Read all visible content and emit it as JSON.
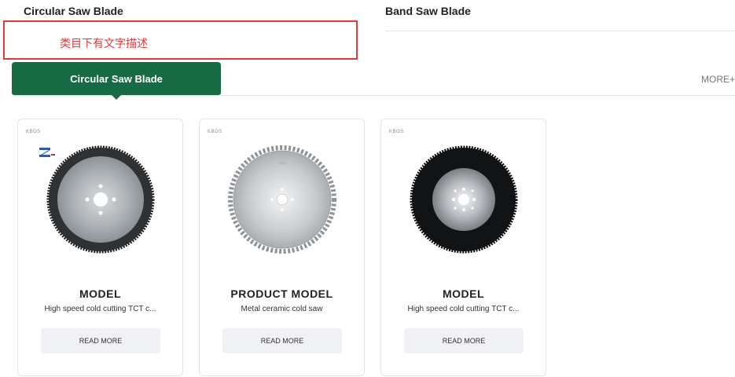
{
  "top_categories": [
    "Circular Saw Blade",
    "Band Saw Blade"
  ],
  "annotation_text": "类目下有文字描述",
  "active_tab": "Circular Saw Blade",
  "more_label": "MORE+",
  "colors": {
    "accent": "#166b45",
    "annotation": "#e03a3a",
    "button_bg": "#f0f1f4"
  },
  "products": [
    {
      "brand": "KBOS",
      "title": "MODEL",
      "description": "High speed cold cutting TCT c...",
      "button_label": "READ MORE",
      "image_icon": "dark-tct-saw-blade-icon"
    },
    {
      "brand": "KBOS",
      "title": "PRODUCT MODEL",
      "description": "Metal ceramic cold saw",
      "button_label": "READ MORE",
      "image_icon": "toothed-cermet-saw-blade-icon"
    },
    {
      "brand": "KBOS",
      "title": "MODEL",
      "description": "High speed cold cutting TCT c...",
      "button_label": "READ MORE",
      "image_icon": "black-coated-saw-blade-icon"
    }
  ]
}
